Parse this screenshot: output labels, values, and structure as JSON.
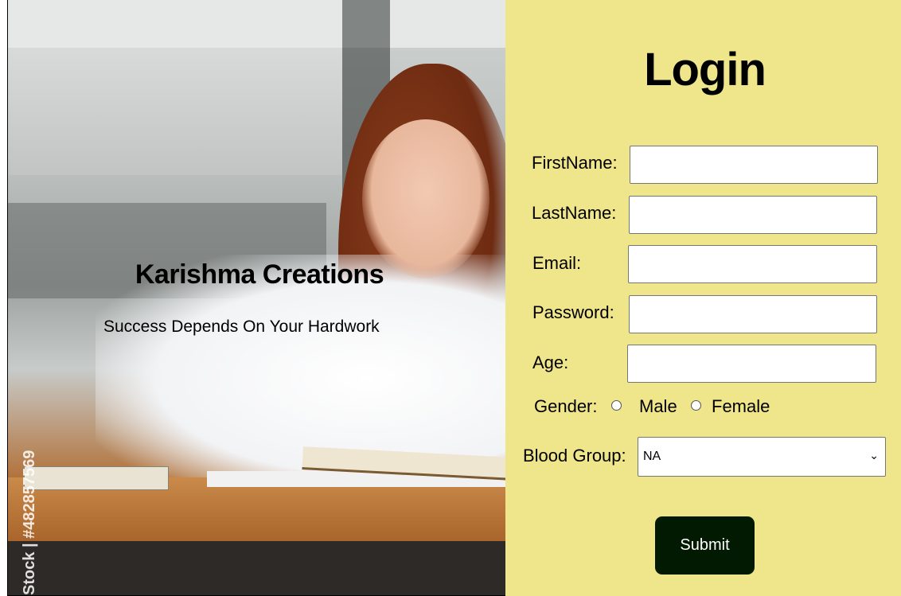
{
  "hero": {
    "brand_title": "Karishma Creations",
    "tagline": "Success Depends On Your Hardwork",
    "watermark": "Stock | #482857569"
  },
  "form": {
    "title": "Login",
    "fields": {
      "firstname_label": "FirstName:",
      "firstname_value": "",
      "lastname_label": "LastName:",
      "lastname_value": "",
      "email_label": "Email:",
      "email_value": "",
      "password_label": "Password:",
      "password_value": "",
      "age_label": "Age:",
      "age_value": ""
    },
    "gender": {
      "label": "Gender:",
      "options": [
        "Male",
        "Female"
      ],
      "selected": null
    },
    "blood_group": {
      "label": "Blood Group:",
      "selected": "NA"
    },
    "submit_label": "Submit"
  },
  "colors": {
    "form_bg": "#efe58b",
    "submit_bg": "#021a02",
    "submit_text": "#ffffff"
  }
}
